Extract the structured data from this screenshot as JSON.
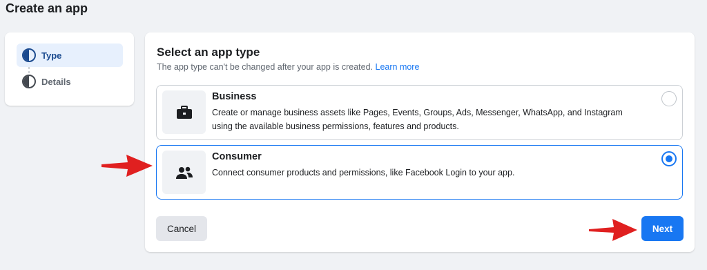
{
  "page": {
    "title": "Create an app"
  },
  "steps": [
    {
      "label": "Type",
      "state": "active",
      "icon": "half-circle-icon"
    },
    {
      "label": "Details",
      "state": "inactive",
      "icon": "half-circle-icon"
    }
  ],
  "main": {
    "title": "Select an app type",
    "subtitle": "The app type can't be changed after your app is created.",
    "learn_more": "Learn more"
  },
  "options": [
    {
      "title": "Business",
      "description": "Create or manage business assets like Pages, Events, Groups, Ads, Messenger, WhatsApp, and Instagram using the available business permissions, features and products.",
      "icon": "briefcase-icon",
      "selected": false
    },
    {
      "title": "Consumer",
      "description": "Connect consumer products and permissions, like Facebook Login to your app.",
      "icon": "people-icon",
      "selected": true
    }
  ],
  "actions": {
    "cancel_label": "Cancel",
    "next_label": "Next"
  },
  "colors": {
    "accent": "#1877f2",
    "annotation_arrow": "#e02020",
    "active_step_bg": "#e7f0fd"
  }
}
